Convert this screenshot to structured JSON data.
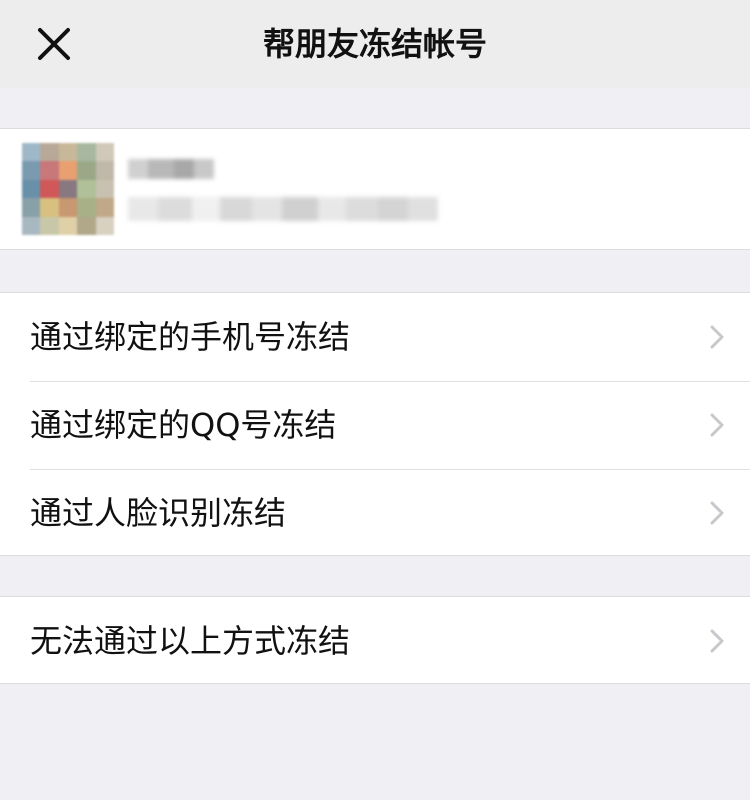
{
  "nav": {
    "title": "帮朋友冻结帐号",
    "close_icon": "close-icon"
  },
  "profile": {
    "avatar_colors": [
      "#9fb8c8",
      "#b8a898",
      "#c8b89a",
      "#a8b8a0",
      "#d0c8b8",
      "#7a9ab0",
      "#c87878",
      "#e8a070",
      "#9aa888",
      "#c0b8a8",
      "#6890a8",
      "#d05858",
      "#887880",
      "#b0c098",
      "#c8c0b0",
      "#88a0a8",
      "#d8c080",
      "#c89870",
      "#a8b088",
      "#c0a888",
      "#a8b8c0",
      "#c8c8a8",
      "#e0d0a8",
      "#b0a888",
      "#d8d0c0"
    ],
    "name_colors": [
      "#d0d0d0",
      "#b8b8b8",
      "#a8a8a8",
      "#c8c8c8"
    ],
    "id_colors": [
      "#e8e8e8",
      "#dcdcdc",
      "#f0f0f0",
      "#d8d8d8",
      "#e4e4e4",
      "#d0d0d0",
      "#e8e8e8",
      "#dcdcdc",
      "#d4d4d4",
      "#e0e0e0"
    ]
  },
  "options": [
    {
      "label": "通过绑定的手机号冻结"
    },
    {
      "label": "通过绑定的QQ号冻结"
    },
    {
      "label": "通过人脸识别冻结"
    }
  ],
  "other_option": {
    "label": "无法通过以上方式冻结"
  },
  "colors": {
    "background": "#efeff4",
    "nav_background": "#ededed",
    "text": "#111111",
    "chevron": "#c7c7cc"
  }
}
